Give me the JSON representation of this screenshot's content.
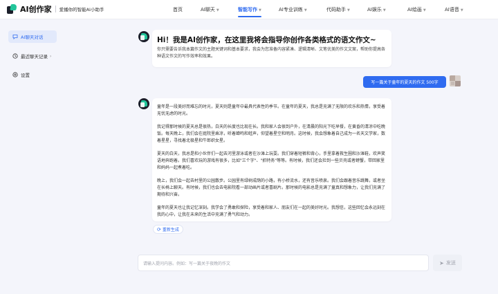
{
  "brand": {
    "name": "AI创作家",
    "slogan": "爱播你的智能AI小助手"
  },
  "nav": {
    "items": [
      {
        "label": "首页",
        "dropdown": false
      },
      {
        "label": "AI聊天",
        "dropdown": true
      },
      {
        "label": "智能写作",
        "dropdown": true,
        "active": true
      },
      {
        "label": "AI专业训练",
        "dropdown": true
      },
      {
        "label": "代码助手",
        "dropdown": true
      },
      {
        "label": "AI娱乐",
        "dropdown": true
      },
      {
        "label": "AI绘画",
        "dropdown": true
      },
      {
        "label": "AI语音",
        "dropdown": true
      }
    ]
  },
  "sidebar": {
    "items": [
      {
        "label": "AI聊天对话",
        "icon": "chat-bubble-icon",
        "active": true
      },
      {
        "label": "最近聊天记录",
        "icon": "clock-icon",
        "chevron": "›"
      },
      {
        "label": "设置",
        "icon": "gear-icon"
      }
    ]
  },
  "chat": {
    "greeting": {
      "title": "Hi！我是AI创作家，在这里我将会指导你创作各类格式的语文作文~",
      "subtitle": "你只需要告诉我本篇作文的主题关键词和基本要求，我会为您准备内容紧凑、逻辑清晰、文笔优美的作文文案，帮助你提高各种语文作文的写作效率和效果。"
    },
    "user_message": "写一篇关于童年的夏天的作文 500字",
    "essay": [
      "童年是一段美好而难忘的时光，夏天则是童年中最具代表性的季节。在童年的夏天，我总是充满了无限的欢乐和热情，享受着无忧无虑的时光。",
      "我记得那时候的夏天总是很热，白天的长度也比现在长。我和家人会很到户外，在清晨的阳光下吃早餐，在黄昏的清凉中吃晚饭。每天晚上，我们会在庭院里乘凉，听着蝉鸣和蛙声，仰望着星空和明月。这时候，我会想象着自己成为一名天文学家，数着星星，寻找着北极星和牛郎织女星。",
      "夏天的白天，我总是和小伙伴们一起去河里游泳或者在沙滩上玩耍。我们穿着短裤和背心，手里拿着救生圈和沙滩鞋，欢声笑语地奔跑着。我们喜欢玩的游戏有很多，比如\"三个字\"、\"抓特务\"等等。有时候，我们还会捡到一些贝壳或者螃蟹，带回家里和妈妈一起煮着吃。",
      "晚上，我们会一起去村里的公园散步。公园里有绿树成荫的小路，有小桥流水，还有音乐喷泉。我们会跟着音乐跳舞，或者坐在长椅上聊天。有时候，我们也会去电影院看一部动画片或者喜剧片。那时候的电影总是充满了童真和想象力，让我们充满了期待和兴奋。",
      "童年的夏天也让我记忆深刻。我学会了勇敢和探险，享受着和家人、朋友们在一起的美好时光。我想信，这些回忆会永远刻在我的心中，让我在未来的生活中充满了勇气和动力。"
    ],
    "regenerate_label": "重新生成"
  },
  "composer": {
    "placeholder": "请输入提问内容。例如：写一篇关于夜晚的作文",
    "send_label": "发送"
  },
  "colors": {
    "accent": "#2f6bf0",
    "brand_green": "#22c59a",
    "background": "#f4f5fb"
  }
}
